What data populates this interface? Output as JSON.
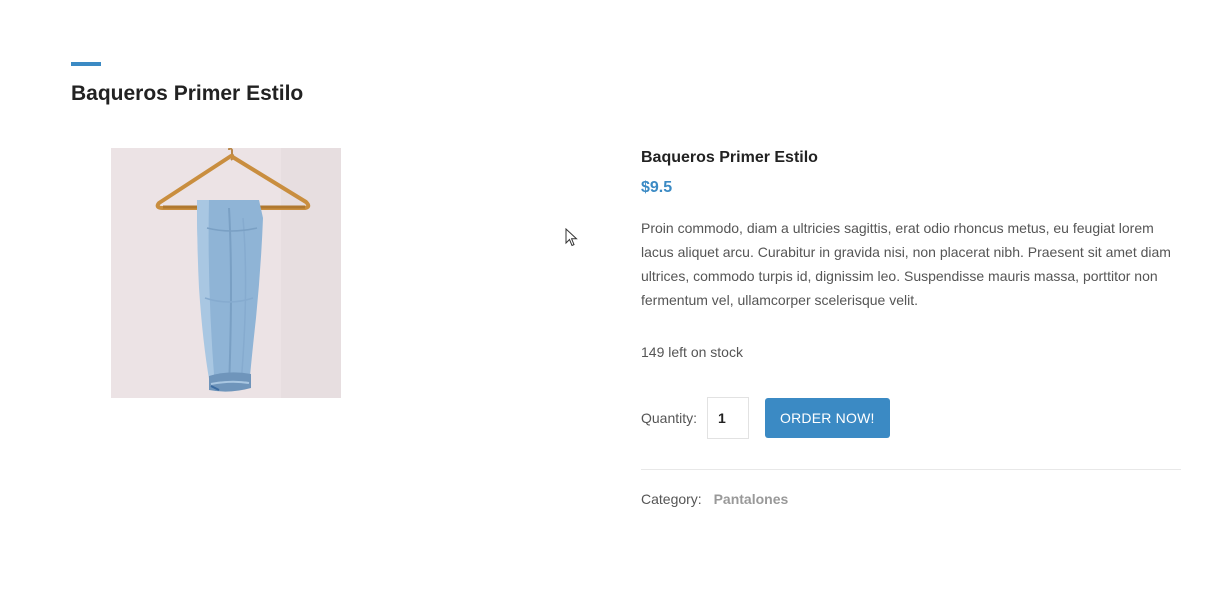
{
  "page": {
    "title": "Baqueros Primer Estilo"
  },
  "product": {
    "name": "Baqueros Primer Estilo",
    "price": "$9.5",
    "description": "Proin commodo, diam a ultricies sagittis, erat odio rhoncus metus, eu feugiat lorem lacus aliquet arcu. Curabitur in gravida nisi, non placerat nibh. Praesent sit amet diam ultrices, commodo turpis id, dignissim leo. Suspendisse mauris massa, porttitor non fermentum vel, ullamcorper scelerisque velit.",
    "stock_text": "149 left on stock",
    "image_icon": "jeans-on-hanger-photo"
  },
  "order": {
    "quantity_label": "Quantity:",
    "quantity_value": "1",
    "button_label": "ORDER NOW!"
  },
  "category": {
    "label": "Category:",
    "value": "Pantalones"
  },
  "colors": {
    "accent": "#3b8ac4",
    "title": "#222222",
    "body_text": "#555555",
    "category_link": "#999999"
  }
}
